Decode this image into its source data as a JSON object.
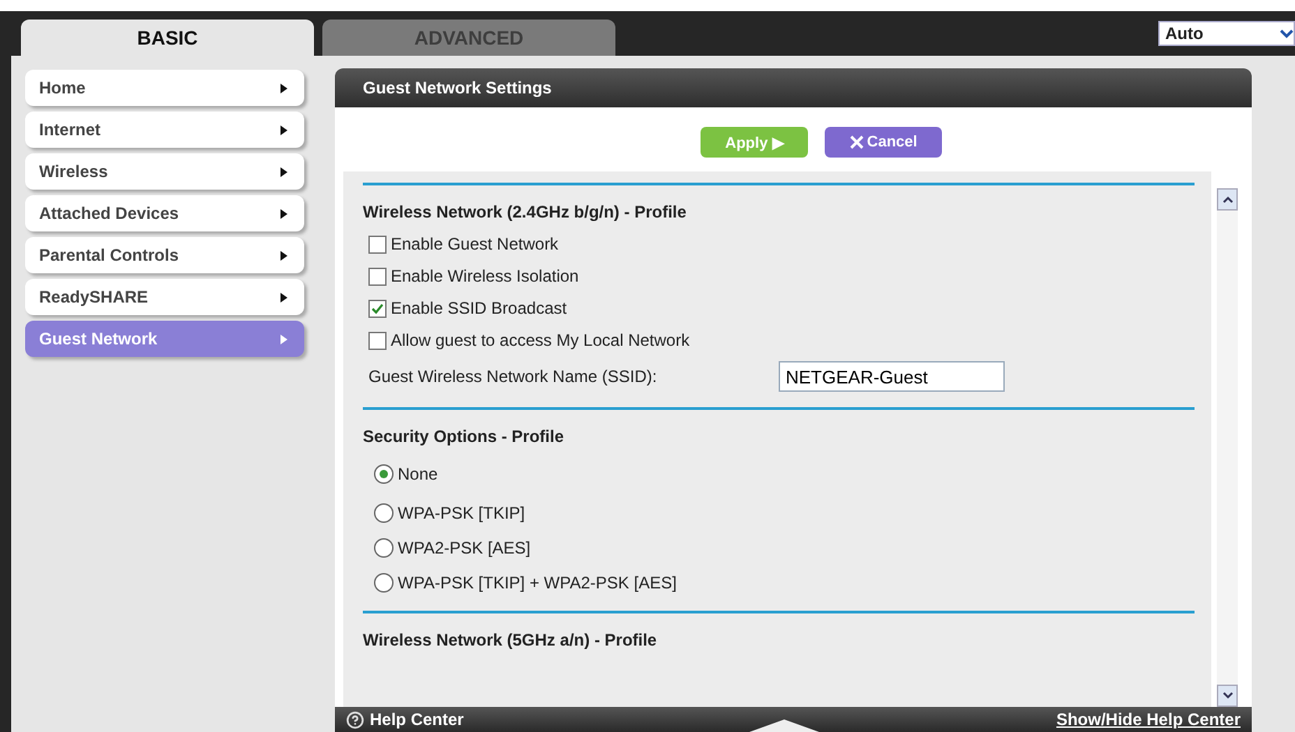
{
  "tabs": [
    {
      "label": "BASIC",
      "selected": true
    },
    {
      "label": "ADVANCED",
      "selected": false
    }
  ],
  "language": {
    "value": "Auto"
  },
  "sidebar": {
    "items": [
      {
        "label": "Home",
        "selected": false
      },
      {
        "label": "Internet",
        "selected": false
      },
      {
        "label": "Wireless",
        "selected": false
      },
      {
        "label": "Attached Devices",
        "selected": false
      },
      {
        "label": "Parental Controls",
        "selected": false
      },
      {
        "label": "ReadySHARE",
        "selected": false
      },
      {
        "label": "Guest Network",
        "selected": true
      }
    ]
  },
  "panel": {
    "title": "Guest Network Settings",
    "buttons": [
      {
        "label": "Apply ▶",
        "kind": "apply"
      },
      {
        "label": "Cancel",
        "kind": "cancel"
      }
    ],
    "sections": [
      {
        "title": "Wireless Network (2.4GHz b/g/n) - Profile",
        "rows": [
          {
            "kind": "checkbox",
            "label": "Enable Guest Network",
            "checked": false
          },
          {
            "kind": "checkbox",
            "label": "Enable Wireless Isolation",
            "checked": false
          },
          {
            "kind": "checkbox",
            "label": "Enable SSID Broadcast",
            "checked": true
          },
          {
            "kind": "checkbox",
            "label": "Allow guest to access My Local Network",
            "checked": false
          },
          {
            "kind": "text",
            "label": "Guest Wireless Network Name (SSID):",
            "value": "NETGEAR-Guest"
          }
        ]
      },
      {
        "title": "Security Options - Profile",
        "rows": [
          {
            "kind": "radio",
            "label": "None",
            "selected": true
          },
          {
            "kind": "radio",
            "label": "WPA-PSK [TKIP]",
            "selected": false
          },
          {
            "kind": "radio",
            "label": "WPA2-PSK [AES]",
            "selected": false
          },
          {
            "kind": "radio",
            "label": "WPA-PSK [TKIP] + WPA2-PSK [AES]",
            "selected": false
          }
        ]
      },
      {
        "title": "Wireless Network (5GHz a/n) - Profile"
      }
    ]
  },
  "help_bar": {
    "title": "Help Center",
    "toggle": "Show/Hide Help Center"
  }
}
